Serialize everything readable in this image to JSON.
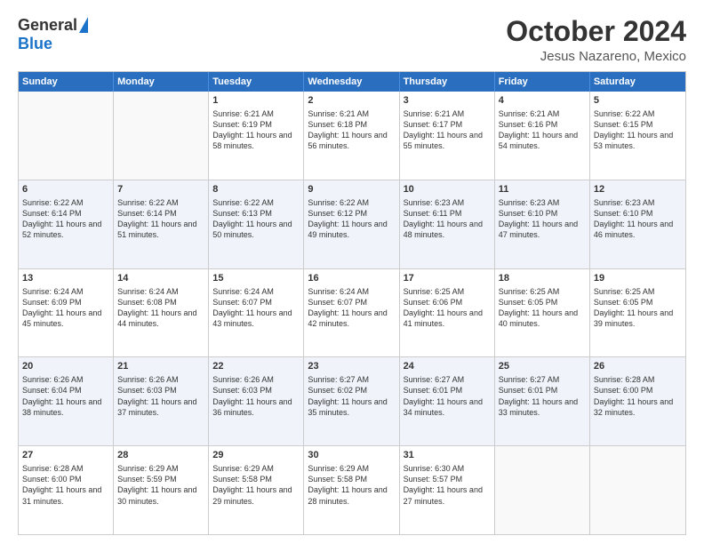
{
  "header": {
    "logo_general": "General",
    "logo_blue": "Blue",
    "main_title": "October 2024",
    "subtitle": "Jesus Nazareno, Mexico"
  },
  "calendar": {
    "days_of_week": [
      "Sunday",
      "Monday",
      "Tuesday",
      "Wednesday",
      "Thursday",
      "Friday",
      "Saturday"
    ],
    "rows": [
      [
        {
          "day": "",
          "sunrise": "",
          "sunset": "",
          "daylight": "",
          "empty": true
        },
        {
          "day": "",
          "sunrise": "",
          "sunset": "",
          "daylight": "",
          "empty": true
        },
        {
          "day": "1",
          "sunrise": "Sunrise: 6:21 AM",
          "sunset": "Sunset: 6:19 PM",
          "daylight": "Daylight: 11 hours and 58 minutes.",
          "empty": false
        },
        {
          "day": "2",
          "sunrise": "Sunrise: 6:21 AM",
          "sunset": "Sunset: 6:18 PM",
          "daylight": "Daylight: 11 hours and 56 minutes.",
          "empty": false
        },
        {
          "day": "3",
          "sunrise": "Sunrise: 6:21 AM",
          "sunset": "Sunset: 6:17 PM",
          "daylight": "Daylight: 11 hours and 55 minutes.",
          "empty": false
        },
        {
          "day": "4",
          "sunrise": "Sunrise: 6:21 AM",
          "sunset": "Sunset: 6:16 PM",
          "daylight": "Daylight: 11 hours and 54 minutes.",
          "empty": false
        },
        {
          "day": "5",
          "sunrise": "Sunrise: 6:22 AM",
          "sunset": "Sunset: 6:15 PM",
          "daylight": "Daylight: 11 hours and 53 minutes.",
          "empty": false
        }
      ],
      [
        {
          "day": "6",
          "sunrise": "Sunrise: 6:22 AM",
          "sunset": "Sunset: 6:14 PM",
          "daylight": "Daylight: 11 hours and 52 minutes.",
          "empty": false
        },
        {
          "day": "7",
          "sunrise": "Sunrise: 6:22 AM",
          "sunset": "Sunset: 6:14 PM",
          "daylight": "Daylight: 11 hours and 51 minutes.",
          "empty": false
        },
        {
          "day": "8",
          "sunrise": "Sunrise: 6:22 AM",
          "sunset": "Sunset: 6:13 PM",
          "daylight": "Daylight: 11 hours and 50 minutes.",
          "empty": false
        },
        {
          "day": "9",
          "sunrise": "Sunrise: 6:22 AM",
          "sunset": "Sunset: 6:12 PM",
          "daylight": "Daylight: 11 hours and 49 minutes.",
          "empty": false
        },
        {
          "day": "10",
          "sunrise": "Sunrise: 6:23 AM",
          "sunset": "Sunset: 6:11 PM",
          "daylight": "Daylight: 11 hours and 48 minutes.",
          "empty": false
        },
        {
          "day": "11",
          "sunrise": "Sunrise: 6:23 AM",
          "sunset": "Sunset: 6:10 PM",
          "daylight": "Daylight: 11 hours and 47 minutes.",
          "empty": false
        },
        {
          "day": "12",
          "sunrise": "Sunrise: 6:23 AM",
          "sunset": "Sunset: 6:10 PM",
          "daylight": "Daylight: 11 hours and 46 minutes.",
          "empty": false
        }
      ],
      [
        {
          "day": "13",
          "sunrise": "Sunrise: 6:24 AM",
          "sunset": "Sunset: 6:09 PM",
          "daylight": "Daylight: 11 hours and 45 minutes.",
          "empty": false
        },
        {
          "day": "14",
          "sunrise": "Sunrise: 6:24 AM",
          "sunset": "Sunset: 6:08 PM",
          "daylight": "Daylight: 11 hours and 44 minutes.",
          "empty": false
        },
        {
          "day": "15",
          "sunrise": "Sunrise: 6:24 AM",
          "sunset": "Sunset: 6:07 PM",
          "daylight": "Daylight: 11 hours and 43 minutes.",
          "empty": false
        },
        {
          "day": "16",
          "sunrise": "Sunrise: 6:24 AM",
          "sunset": "Sunset: 6:07 PM",
          "daylight": "Daylight: 11 hours and 42 minutes.",
          "empty": false
        },
        {
          "day": "17",
          "sunrise": "Sunrise: 6:25 AM",
          "sunset": "Sunset: 6:06 PM",
          "daylight": "Daylight: 11 hours and 41 minutes.",
          "empty": false
        },
        {
          "day": "18",
          "sunrise": "Sunrise: 6:25 AM",
          "sunset": "Sunset: 6:05 PM",
          "daylight": "Daylight: 11 hours and 40 minutes.",
          "empty": false
        },
        {
          "day": "19",
          "sunrise": "Sunrise: 6:25 AM",
          "sunset": "Sunset: 6:05 PM",
          "daylight": "Daylight: 11 hours and 39 minutes.",
          "empty": false
        }
      ],
      [
        {
          "day": "20",
          "sunrise": "Sunrise: 6:26 AM",
          "sunset": "Sunset: 6:04 PM",
          "daylight": "Daylight: 11 hours and 38 minutes.",
          "empty": false
        },
        {
          "day": "21",
          "sunrise": "Sunrise: 6:26 AM",
          "sunset": "Sunset: 6:03 PM",
          "daylight": "Daylight: 11 hours and 37 minutes.",
          "empty": false
        },
        {
          "day": "22",
          "sunrise": "Sunrise: 6:26 AM",
          "sunset": "Sunset: 6:03 PM",
          "daylight": "Daylight: 11 hours and 36 minutes.",
          "empty": false
        },
        {
          "day": "23",
          "sunrise": "Sunrise: 6:27 AM",
          "sunset": "Sunset: 6:02 PM",
          "daylight": "Daylight: 11 hours and 35 minutes.",
          "empty": false
        },
        {
          "day": "24",
          "sunrise": "Sunrise: 6:27 AM",
          "sunset": "Sunset: 6:01 PM",
          "daylight": "Daylight: 11 hours and 34 minutes.",
          "empty": false
        },
        {
          "day": "25",
          "sunrise": "Sunrise: 6:27 AM",
          "sunset": "Sunset: 6:01 PM",
          "daylight": "Daylight: 11 hours and 33 minutes.",
          "empty": false
        },
        {
          "day": "26",
          "sunrise": "Sunrise: 6:28 AM",
          "sunset": "Sunset: 6:00 PM",
          "daylight": "Daylight: 11 hours and 32 minutes.",
          "empty": false
        }
      ],
      [
        {
          "day": "27",
          "sunrise": "Sunrise: 6:28 AM",
          "sunset": "Sunset: 6:00 PM",
          "daylight": "Daylight: 11 hours and 31 minutes.",
          "empty": false
        },
        {
          "day": "28",
          "sunrise": "Sunrise: 6:29 AM",
          "sunset": "Sunset: 5:59 PM",
          "daylight": "Daylight: 11 hours and 30 minutes.",
          "empty": false
        },
        {
          "day": "29",
          "sunrise": "Sunrise: 6:29 AM",
          "sunset": "Sunset: 5:58 PM",
          "daylight": "Daylight: 11 hours and 29 minutes.",
          "empty": false
        },
        {
          "day": "30",
          "sunrise": "Sunrise: 6:29 AM",
          "sunset": "Sunset: 5:58 PM",
          "daylight": "Daylight: 11 hours and 28 minutes.",
          "empty": false
        },
        {
          "day": "31",
          "sunrise": "Sunrise: 6:30 AM",
          "sunset": "Sunset: 5:57 PM",
          "daylight": "Daylight: 11 hours and 27 minutes.",
          "empty": false
        },
        {
          "day": "",
          "sunrise": "",
          "sunset": "",
          "daylight": "",
          "empty": true
        },
        {
          "day": "",
          "sunrise": "",
          "sunset": "",
          "daylight": "",
          "empty": true
        }
      ]
    ]
  }
}
